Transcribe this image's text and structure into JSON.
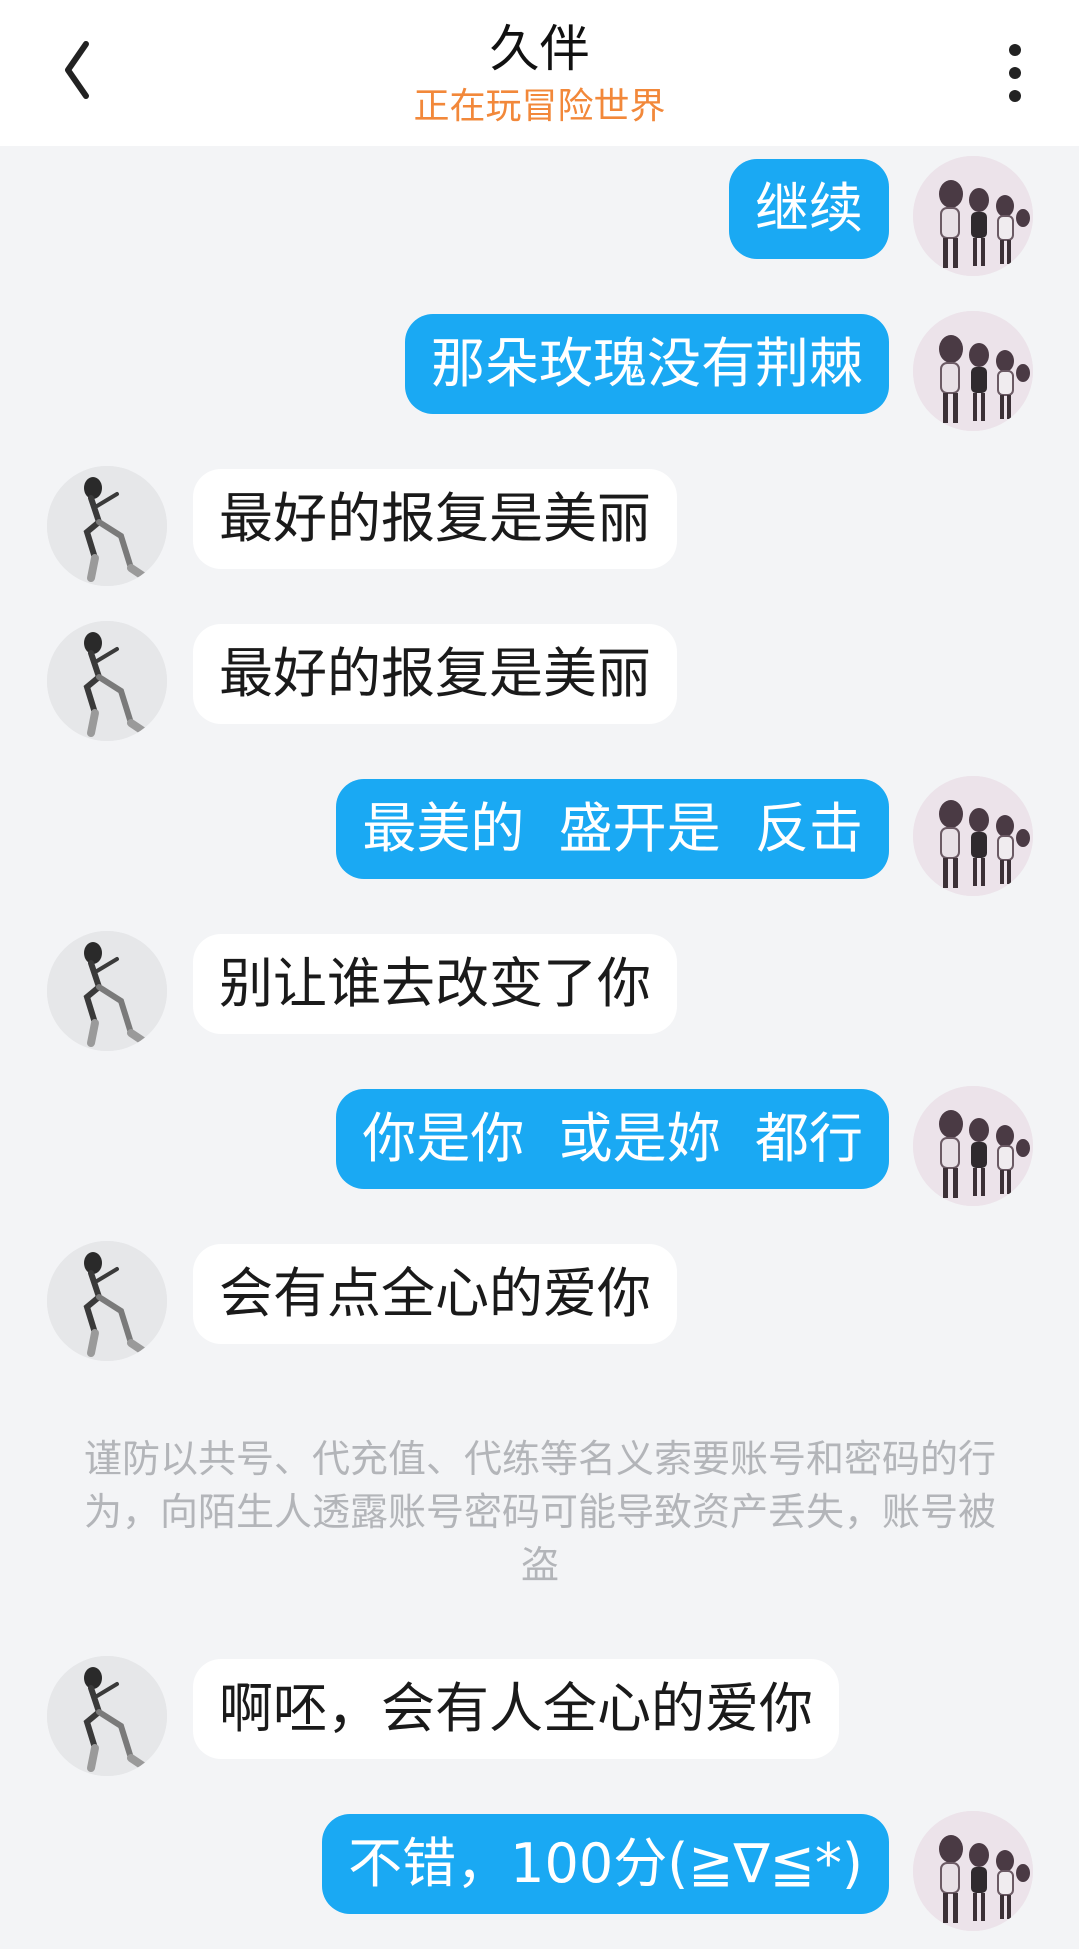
{
  "header": {
    "title": "久伴",
    "status": "正在玩冒险世界"
  },
  "messages": [
    {
      "side": "right",
      "text": "继续"
    },
    {
      "side": "right",
      "text": "那朵玫瑰没有荆棘"
    },
    {
      "side": "left",
      "text": "最好的报复是美丽"
    },
    {
      "side": "left",
      "text": "最好的报复是美丽"
    },
    {
      "side": "right",
      "text": "最美的  盛开是  反击"
    },
    {
      "side": "left",
      "text": "别让谁去改变了你"
    },
    {
      "side": "right",
      "text": "你是你  或是妳  都行"
    },
    {
      "side": "left",
      "text": "会有点全心的爱你"
    },
    {
      "side": "left",
      "text": "啊呸，会有人全心的爱你"
    },
    {
      "side": "right",
      "text": "不错，100分(≧∇≦*)"
    }
  ],
  "security_notice": "谨防以共号、代充值、代练等名义索要账号和密码的行为，向陌生人透露账号密码可能导致资产丢失，账号被盗",
  "colors": {
    "accent": "#1aa9f3",
    "status": "#f2883a",
    "background": "#f3f4f6"
  }
}
